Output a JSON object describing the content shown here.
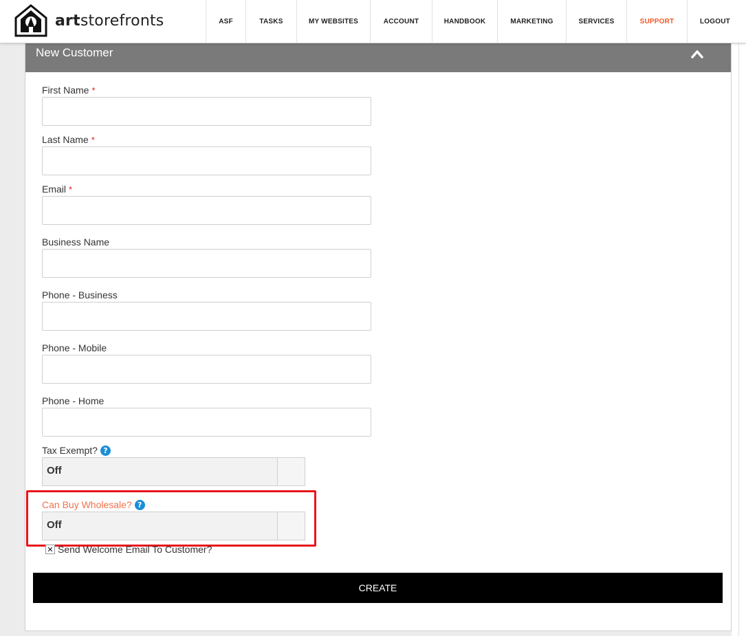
{
  "header": {
    "logo_text_bold": "art",
    "logo_text_rest": "storefronts",
    "nav": [
      {
        "label": "ASF",
        "active": false
      },
      {
        "label": "TASKS",
        "active": false
      },
      {
        "label": "MY WEBSITES",
        "active": false
      },
      {
        "label": "ACCOUNT",
        "active": false
      },
      {
        "label": "HANDBOOK",
        "active": false
      },
      {
        "label": "MARKETING",
        "active": false
      },
      {
        "label": "SERVICES",
        "active": false
      },
      {
        "label": "SUPPORT",
        "active": true
      },
      {
        "label": "LOGOUT",
        "active": false
      }
    ]
  },
  "panel": {
    "title": "New Customer",
    "collapse_icon": "chevron-up-icon"
  },
  "form": {
    "first_name": {
      "label": "First Name",
      "required": "*",
      "value": ""
    },
    "last_name": {
      "label": "Last Name",
      "required": "*",
      "value": ""
    },
    "email": {
      "label": "Email",
      "required": "*",
      "value": ""
    },
    "business_name": {
      "label": "Business Name",
      "value": ""
    },
    "phone_business": {
      "label": "Phone - Business",
      "value": ""
    },
    "phone_mobile": {
      "label": "Phone - Mobile",
      "value": ""
    },
    "phone_home": {
      "label": "Phone - Home",
      "value": ""
    },
    "tax_exempt": {
      "label": "Tax Exempt?",
      "value": "Off",
      "help_icon": "question-circle-icon"
    },
    "can_buy_wholesale": {
      "label": "Can Buy Wholesale?",
      "value": "Off",
      "help_icon": "question-circle-icon"
    },
    "send_welcome_email": {
      "label": "Send Welcome Email To Customer?",
      "checked_mark": "✕"
    },
    "create_label": "CREATE"
  },
  "colors": {
    "accent_orange": "#f05a28",
    "panel_header": "#7a7a7a",
    "highlight_red": "#e8141b",
    "help_blue": "#1a8ed8"
  }
}
